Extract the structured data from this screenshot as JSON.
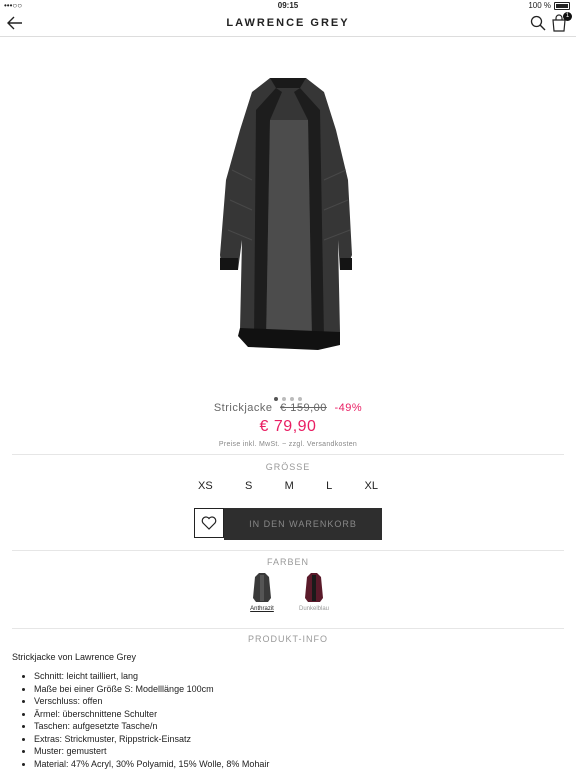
{
  "status_bar": {
    "signal": "•••○○",
    "time": "09:15",
    "battery": "100 %"
  },
  "nav": {
    "title": "LAWRENCE GREY",
    "cart_count": "1"
  },
  "product": {
    "name": "Strickjacke",
    "old_price": "€ 159,00",
    "discount": "-49%",
    "price": "€ 79,90",
    "price_note": "Preise inkl. MwSt. ~ zzgl. Versandkosten"
  },
  "sizes_title": "GRÖSSE",
  "sizes": [
    "XS",
    "S",
    "M",
    "L",
    "XL"
  ],
  "add_to_cart": "IN DEN WARENKORB",
  "colors_title": "FARBEN",
  "colors": [
    {
      "label": "Anthrazit",
      "color": "#3a3a3a"
    },
    {
      "label": "Dunkelblau",
      "color": "#5a1a2a"
    }
  ],
  "info_title": "PRODUKT-INFO",
  "description": "Strickjacke von Lawrence Grey",
  "details": [
    "Schnitt: leicht tailliert, lang",
    "Maße bei einer Größe S: Modelllänge 100cm",
    "Verschluss: offen",
    "Ärmel: überschnittene Schulter",
    "Taschen: aufgesetzte Tasche/n",
    "Extras: Strickmuster, Rippstrick-Einsatz",
    "Muster: gemustert",
    "Material: 47% Acryl, 30% Polyamid, 15% Wolle, 8% Mohair"
  ]
}
